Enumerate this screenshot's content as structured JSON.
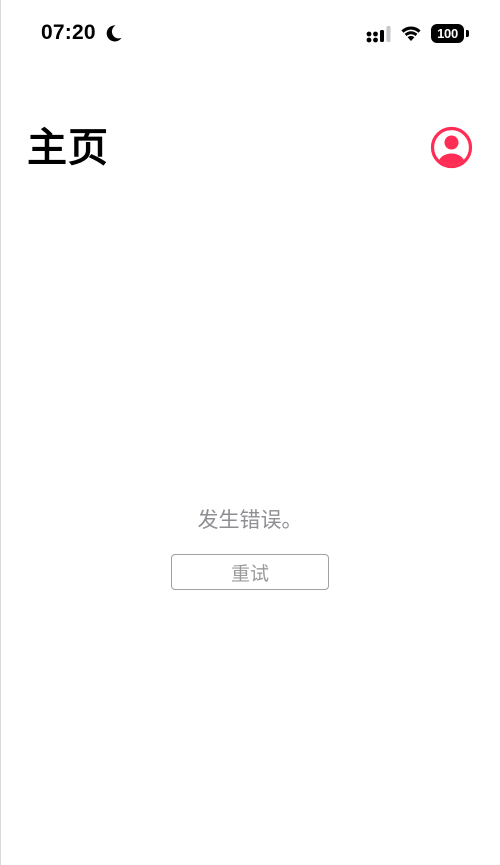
{
  "status_bar": {
    "time": "07:20",
    "moon_icon": "moon-icon",
    "signal_icon": "cellular-signal-icon",
    "wifi_icon": "wifi-icon",
    "battery_level": "100"
  },
  "header": {
    "title": "主页",
    "account_icon": "person-circle-icon",
    "accent_color": "#ff2d55"
  },
  "main": {
    "error_message": "发生错误。",
    "retry_label": "重试"
  }
}
